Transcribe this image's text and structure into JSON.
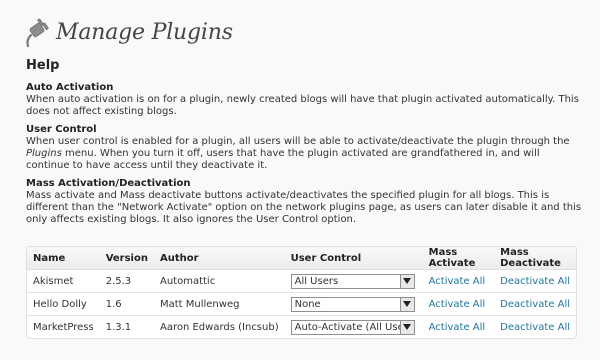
{
  "header": {
    "title": "Manage Plugins"
  },
  "help": {
    "title": "Help",
    "sections": [
      {
        "heading": "Auto Activation",
        "text": "When auto activation is on for a plugin, newly created blogs will have that plugin activated automatically. This does not affect existing blogs."
      },
      {
        "heading": "User Control",
        "text_before": "When user control is enabled for a plugin, all users will be able to activate/deactivate the plugin through the ",
        "text_em": "Plugins",
        "text_after": " menu. When you turn it off, users that have the plugin activated are grandfathered in, and will continue to have access until they deactivate it."
      },
      {
        "heading": "Mass Activation/Deactivation",
        "text": "Mass activate and Mass deactivate buttons activate/deactivates the specified plugin for all blogs. This is different than the \"Network Activate\" option on the network plugins page, as users can later disable it and this only affects existing blogs. It also ignores the User Control option."
      }
    ]
  },
  "table": {
    "headers": [
      "Name",
      "Version",
      "Author",
      "User Control",
      "Mass Activate",
      "Mass Deactivate"
    ],
    "rows": [
      {
        "name": "Akismet",
        "version": "2.5.3",
        "author": "Automattic",
        "user_control": "All Users",
        "activate": "Activate All",
        "deactivate": "Deactivate All"
      },
      {
        "name": "Hello Dolly",
        "version": "1.6",
        "author": "Matt Mullenweg",
        "user_control": "None",
        "activate": "Activate All",
        "deactivate": "Deactivate All"
      },
      {
        "name": "MarketPress",
        "version": "1.3.1",
        "author": "Aaron Edwards (Incsub)",
        "user_control": "Auto-Activate (All Users)",
        "activate": "Activate All",
        "deactivate": "Deactivate All"
      }
    ]
  },
  "icons": {
    "page_icon": "plugin-plug-icon",
    "select_arrow": "chevron-down-icon"
  },
  "colors": {
    "link": "#21759b",
    "title": "#464646",
    "background": "#f9f9f9"
  }
}
